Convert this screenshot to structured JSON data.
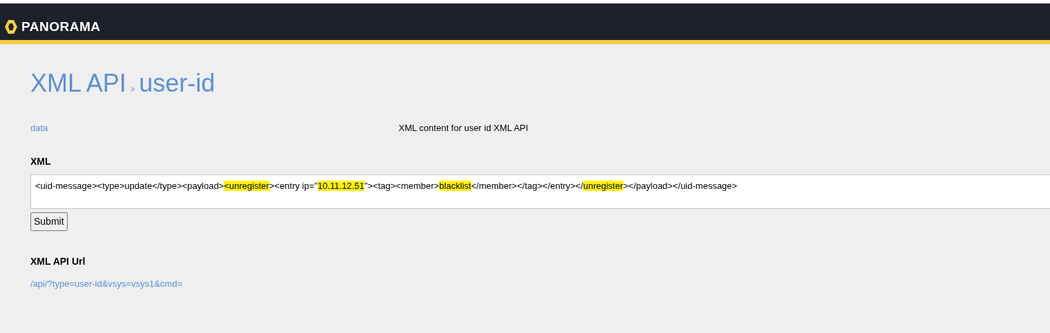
{
  "header": {
    "logo_text": "PANORAMA"
  },
  "breadcrumb": {
    "root": "XML API",
    "separator": ">",
    "current": "user-id"
  },
  "parameter": {
    "name": "data",
    "description": "XML content for user id XML API"
  },
  "xml_field": {
    "label": "XML",
    "value": [
      {
        "text": "<uid-message><type>update</type><payload>",
        "highlighted": false
      },
      {
        "text": "<unregister",
        "highlighted": true
      },
      {
        "text": "><entry ip=\"",
        "highlighted": false
      },
      {
        "text": "10.11.12.51",
        "highlighted": true
      },
      {
        "text": "\"><tag><member>",
        "highlighted": false
      },
      {
        "text": "blacklist",
        "highlighted": true
      },
      {
        "text": "</member></tag></entry></",
        "highlighted": false
      },
      {
        "text": "unregister",
        "highlighted": true
      },
      {
        "text": "></payload></uid-message>",
        "highlighted": false
      }
    ]
  },
  "submit_button": "Submit",
  "url_section": {
    "label": "XML API Url",
    "url": "/api/?type=user-id&vsys=vsys1&cmd="
  }
}
